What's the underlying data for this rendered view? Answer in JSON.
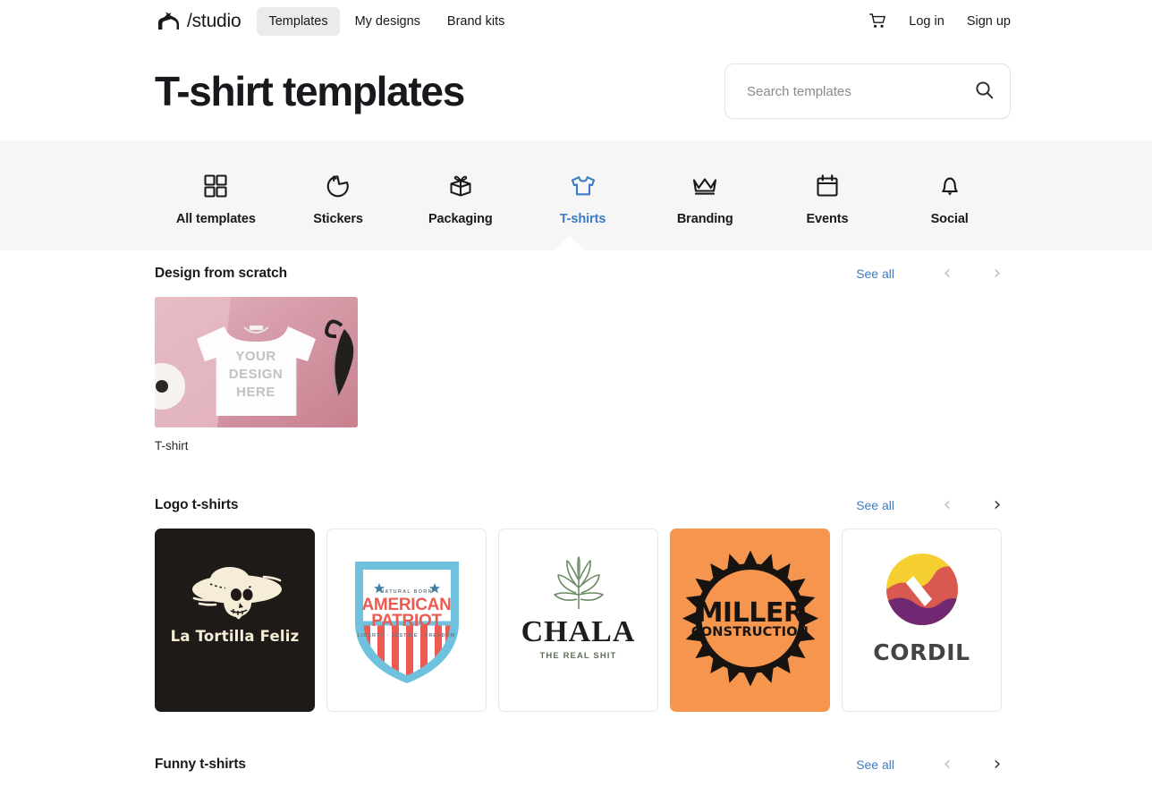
{
  "header": {
    "logo_text": "/studio",
    "logo_icon": "horse-icon",
    "nav": [
      {
        "label": "Templates",
        "active": true
      },
      {
        "label": "My designs",
        "active": false
      },
      {
        "label": "Brand kits",
        "active": false
      }
    ],
    "cart_icon": "shopping-cart-icon",
    "login_label": "Log in",
    "signup_label": "Sign up"
  },
  "page": {
    "title": "T-shirt templates"
  },
  "search": {
    "placeholder": "Search templates",
    "value": "",
    "icon": "search-icon"
  },
  "categories": [
    {
      "label": "All templates",
      "icon": "grid-icon",
      "active": false
    },
    {
      "label": "Stickers",
      "icon": "sticker-icon",
      "active": false
    },
    {
      "label": "Packaging",
      "icon": "gift-box-icon",
      "active": false
    },
    {
      "label": "T-shirts",
      "icon": "tshirt-icon",
      "active": true
    },
    {
      "label": "Branding",
      "icon": "crown-icon",
      "active": false
    },
    {
      "label": "Events",
      "icon": "calendar-icon",
      "active": false
    },
    {
      "label": "Social",
      "icon": "bell-icon",
      "active": false
    }
  ],
  "colors": {
    "accent": "#3b7cc4",
    "nav_bg": "#f6f6f6",
    "text": "#17191c",
    "arrow_disabled": "#c2c2c2",
    "arrow_enabled": "#3a3a3a"
  },
  "sections": [
    {
      "title": "Design from scratch",
      "see_all": "See all",
      "prev_enabled": false,
      "next_enabled": false,
      "cards": [
        {
          "type": "mockup",
          "caption": "T-shirt",
          "overlay_lines": [
            "YOUR",
            "DESIGN",
            "HERE"
          ]
        }
      ]
    },
    {
      "title": "Logo t-shirts",
      "see_all": "See all",
      "prev_enabled": false,
      "next_enabled": true,
      "cards": [
        {
          "type": "tortilla",
          "title": "La Tortilla Feliz"
        },
        {
          "type": "patriot",
          "top": "NATURAL BORN",
          "main_line1": "AMERICAN",
          "main_line2": "PATRIOT",
          "sub": "LIBERTY · JUSTICE · FREEDOM"
        },
        {
          "type": "chala",
          "main": "CHALA",
          "sub": "THE REAL SHIT"
        },
        {
          "type": "miller",
          "main": "MILLER",
          "sub": "CONSTRUCTION"
        },
        {
          "type": "cordil",
          "main": "CORDIL"
        }
      ]
    },
    {
      "title": "Funny t-shirts",
      "see_all": "See all",
      "prev_enabled": false,
      "next_enabled": true,
      "cards": []
    }
  ],
  "glyphs": {
    "chevron_left": "‹",
    "chevron_right": "›"
  }
}
